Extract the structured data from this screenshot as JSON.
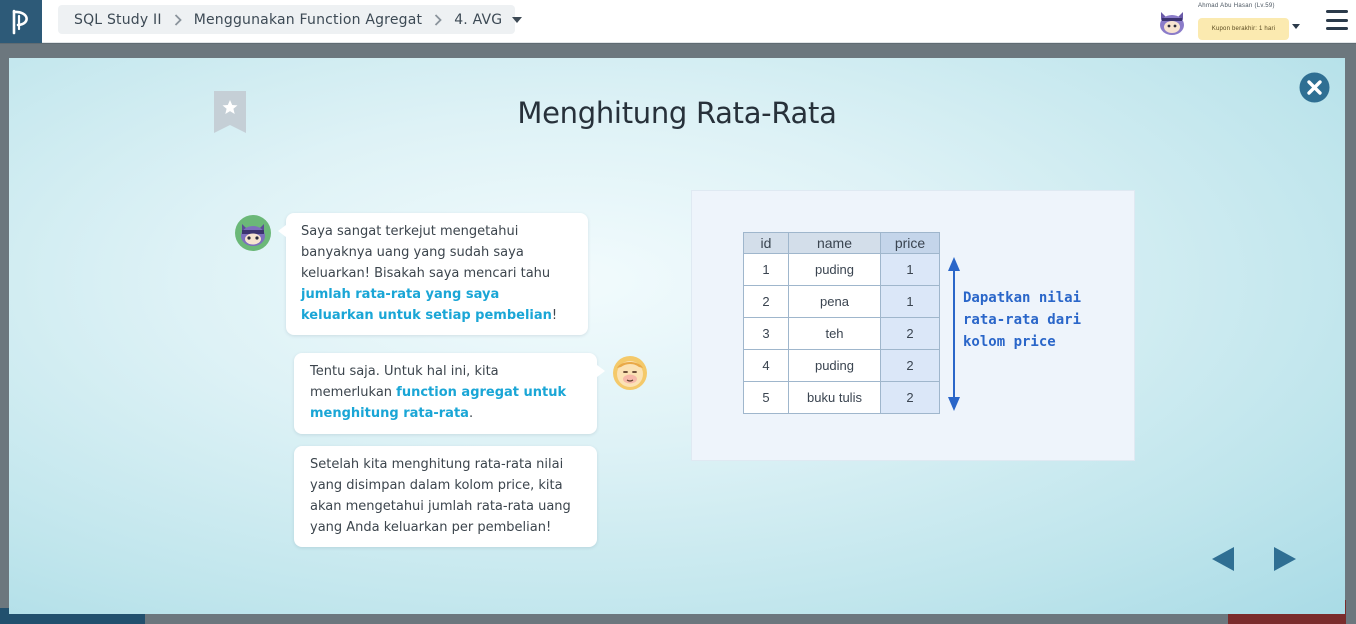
{
  "nav": {
    "logo_icon": "paiza-logo-icon",
    "breadcrumb": {
      "course": "SQL Study II",
      "chapter": "Menggunakan Function Agregat",
      "lesson": "4. AVG"
    },
    "user": {
      "name": "Ahmad Abu Hasan (Lv.59)",
      "coupon": "Kupon berakhir: 1 hari"
    }
  },
  "slide": {
    "title": "Menghitung Rata-Rata",
    "dialog": [
      {
        "speaker": "ninja-cat",
        "text_before": "Saya sangat terkejut mengetahui banyaknya uang yang sudah saya keluarkan! Bisakah saya  mencari tahu ",
        "highlight": "jumlah rata-rata yang saya keluarkan untuk setiap pembelian",
        "text_after": "!"
      },
      {
        "speaker": "guide",
        "text_before": "Tentu saja. Untuk hal ini, kita memerlukan ",
        "highlight": "function agregat untuk menghitung rata-rata",
        "text_after": "."
      },
      {
        "speaker": "guide",
        "text_before": "Setelah kita menghitung rata-rata nilai yang disimpan dalam kolom price, kita akan mengetahui jumlah rata-rata uang yang Anda keluarkan per pembelian!",
        "highlight": "",
        "text_after": ""
      }
    ],
    "table": {
      "columns": [
        "id",
        "name",
        "price"
      ],
      "rows": [
        [
          "1",
          "puding",
          "1"
        ],
        [
          "2",
          "pena",
          "1"
        ],
        [
          "3",
          "teh",
          "2"
        ],
        [
          "4",
          "puding",
          "2"
        ],
        [
          "5",
          "buku tulis",
          "2"
        ]
      ]
    },
    "annotation": "Dapatkan nilai rata-rata dari kolom price"
  },
  "colors": {
    "accent": "#1aa6d6",
    "nav_button": "#2f6f93",
    "annotation": "#2a66c9"
  }
}
